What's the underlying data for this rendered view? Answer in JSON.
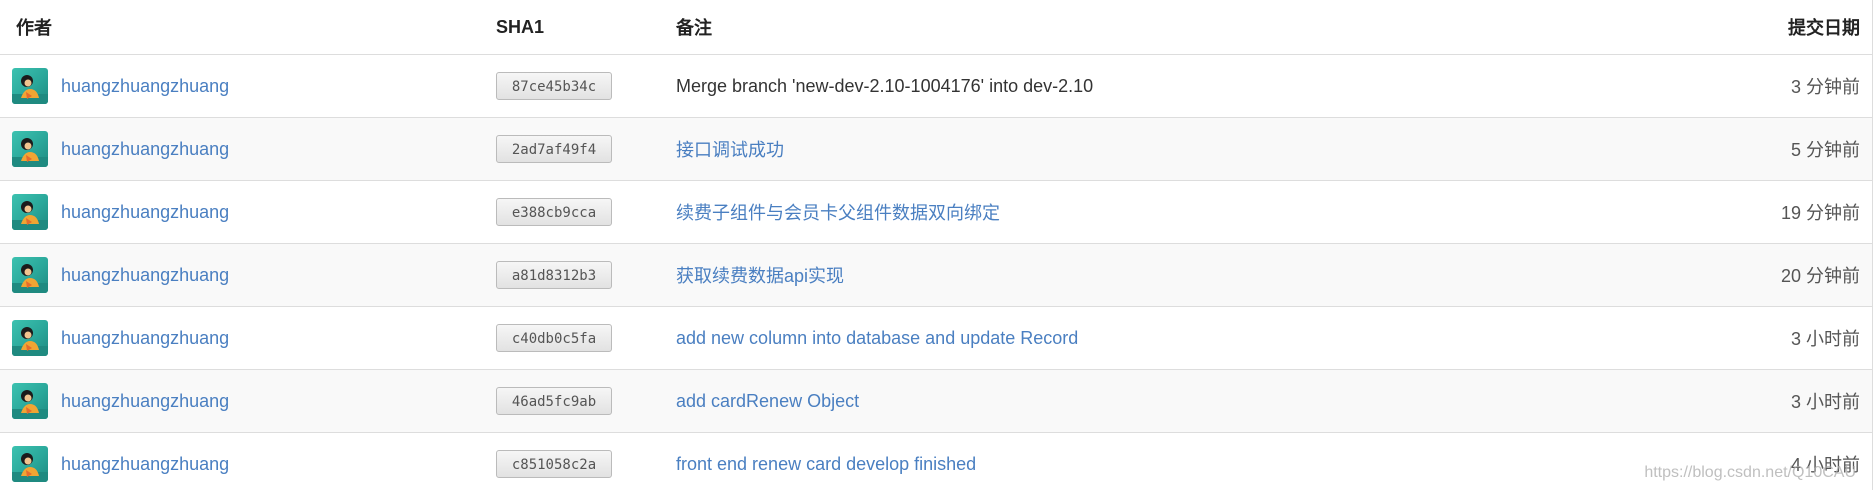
{
  "table": {
    "headers": {
      "author": "作者",
      "sha": "SHA1",
      "note": "备注",
      "date": "提交日期"
    },
    "rows": [
      {
        "author": "huangzhuangzhuang",
        "sha": "87ce45b34c",
        "note": "Merge branch 'new-dev-2.10-1004176' into dev-2.10",
        "date": "3 分钟前"
      },
      {
        "author": "huangzhuangzhuang",
        "sha": "2ad7af49f4",
        "note": "接口调试成功",
        "date": "5 分钟前"
      },
      {
        "author": "huangzhuangzhuang",
        "sha": "e388cb9cca",
        "note": "续费子组件与会员卡父组件数据双向绑定",
        "date": "19 分钟前"
      },
      {
        "author": "huangzhuangzhuang",
        "sha": "a81d8312b3",
        "note": "获取续费数据api实现",
        "date": "20 分钟前"
      },
      {
        "author": "huangzhuangzhuang",
        "sha": "c40db0c5fa",
        "note": "add new column into database and update Record",
        "date": "3 小时前"
      },
      {
        "author": "huangzhuangzhuang",
        "sha": "46ad5fc9ab",
        "note": "add cardRenew Object",
        "date": "3 小时前"
      },
      {
        "author": "huangzhuangzhuang",
        "sha": "c851058c2a",
        "note": "front end renew card develop finished",
        "date": "4 小时前"
      }
    ]
  },
  "watermark": "https://blog.csdn.net/Q10CAU",
  "colors": {
    "link": "#4a7fc1",
    "border": "#dddddd",
    "alt_row": "#f9f9f9",
    "avatar_bg": "#2aa79a"
  },
  "icons": {
    "avatar": "user-avatar-icon"
  }
}
